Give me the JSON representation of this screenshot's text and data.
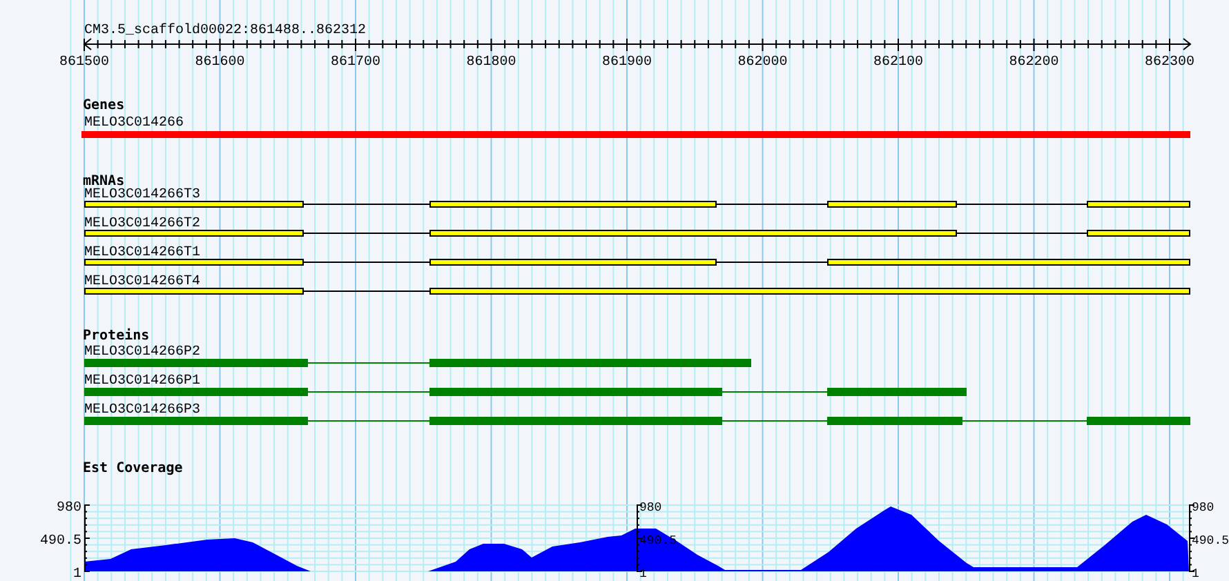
{
  "ruler": {
    "title": "CM3.5_scaffold00022:861488..862312",
    "labels": [
      "861500",
      "861600",
      "861700",
      "861800",
      "861900",
      "862000",
      "862100",
      "862200",
      "862300"
    ]
  },
  "tracks": [
    {
      "kind": "gene",
      "title": "Genes",
      "features": [
        {
          "name": "MELO3C014266"
        }
      ]
    },
    {
      "kind": "mrna",
      "title": "mRNAs",
      "features": [
        {
          "name": "MELO3C014266T3"
        },
        {
          "name": "MELO3C014266T2"
        },
        {
          "name": "MELO3C014266T1"
        },
        {
          "name": "MELO3C014266T4"
        }
      ]
    },
    {
      "kind": "protein",
      "title": "Proteins",
      "features": [
        {
          "name": "MELO3C014266P2"
        },
        {
          "name": "MELO3C014266P1"
        },
        {
          "name": "MELO3C014266P3"
        }
      ]
    },
    {
      "kind": "coverage",
      "title": "Est Coverage",
      "axes": [
        {
          "labels": [
            "980",
            "490.5",
            "1"
          ]
        },
        {
          "labels": [
            "980",
            "490.5",
            "1"
          ]
        },
        {
          "labels": [
            "980",
            "490.5",
            "1"
          ]
        }
      ]
    }
  ]
}
